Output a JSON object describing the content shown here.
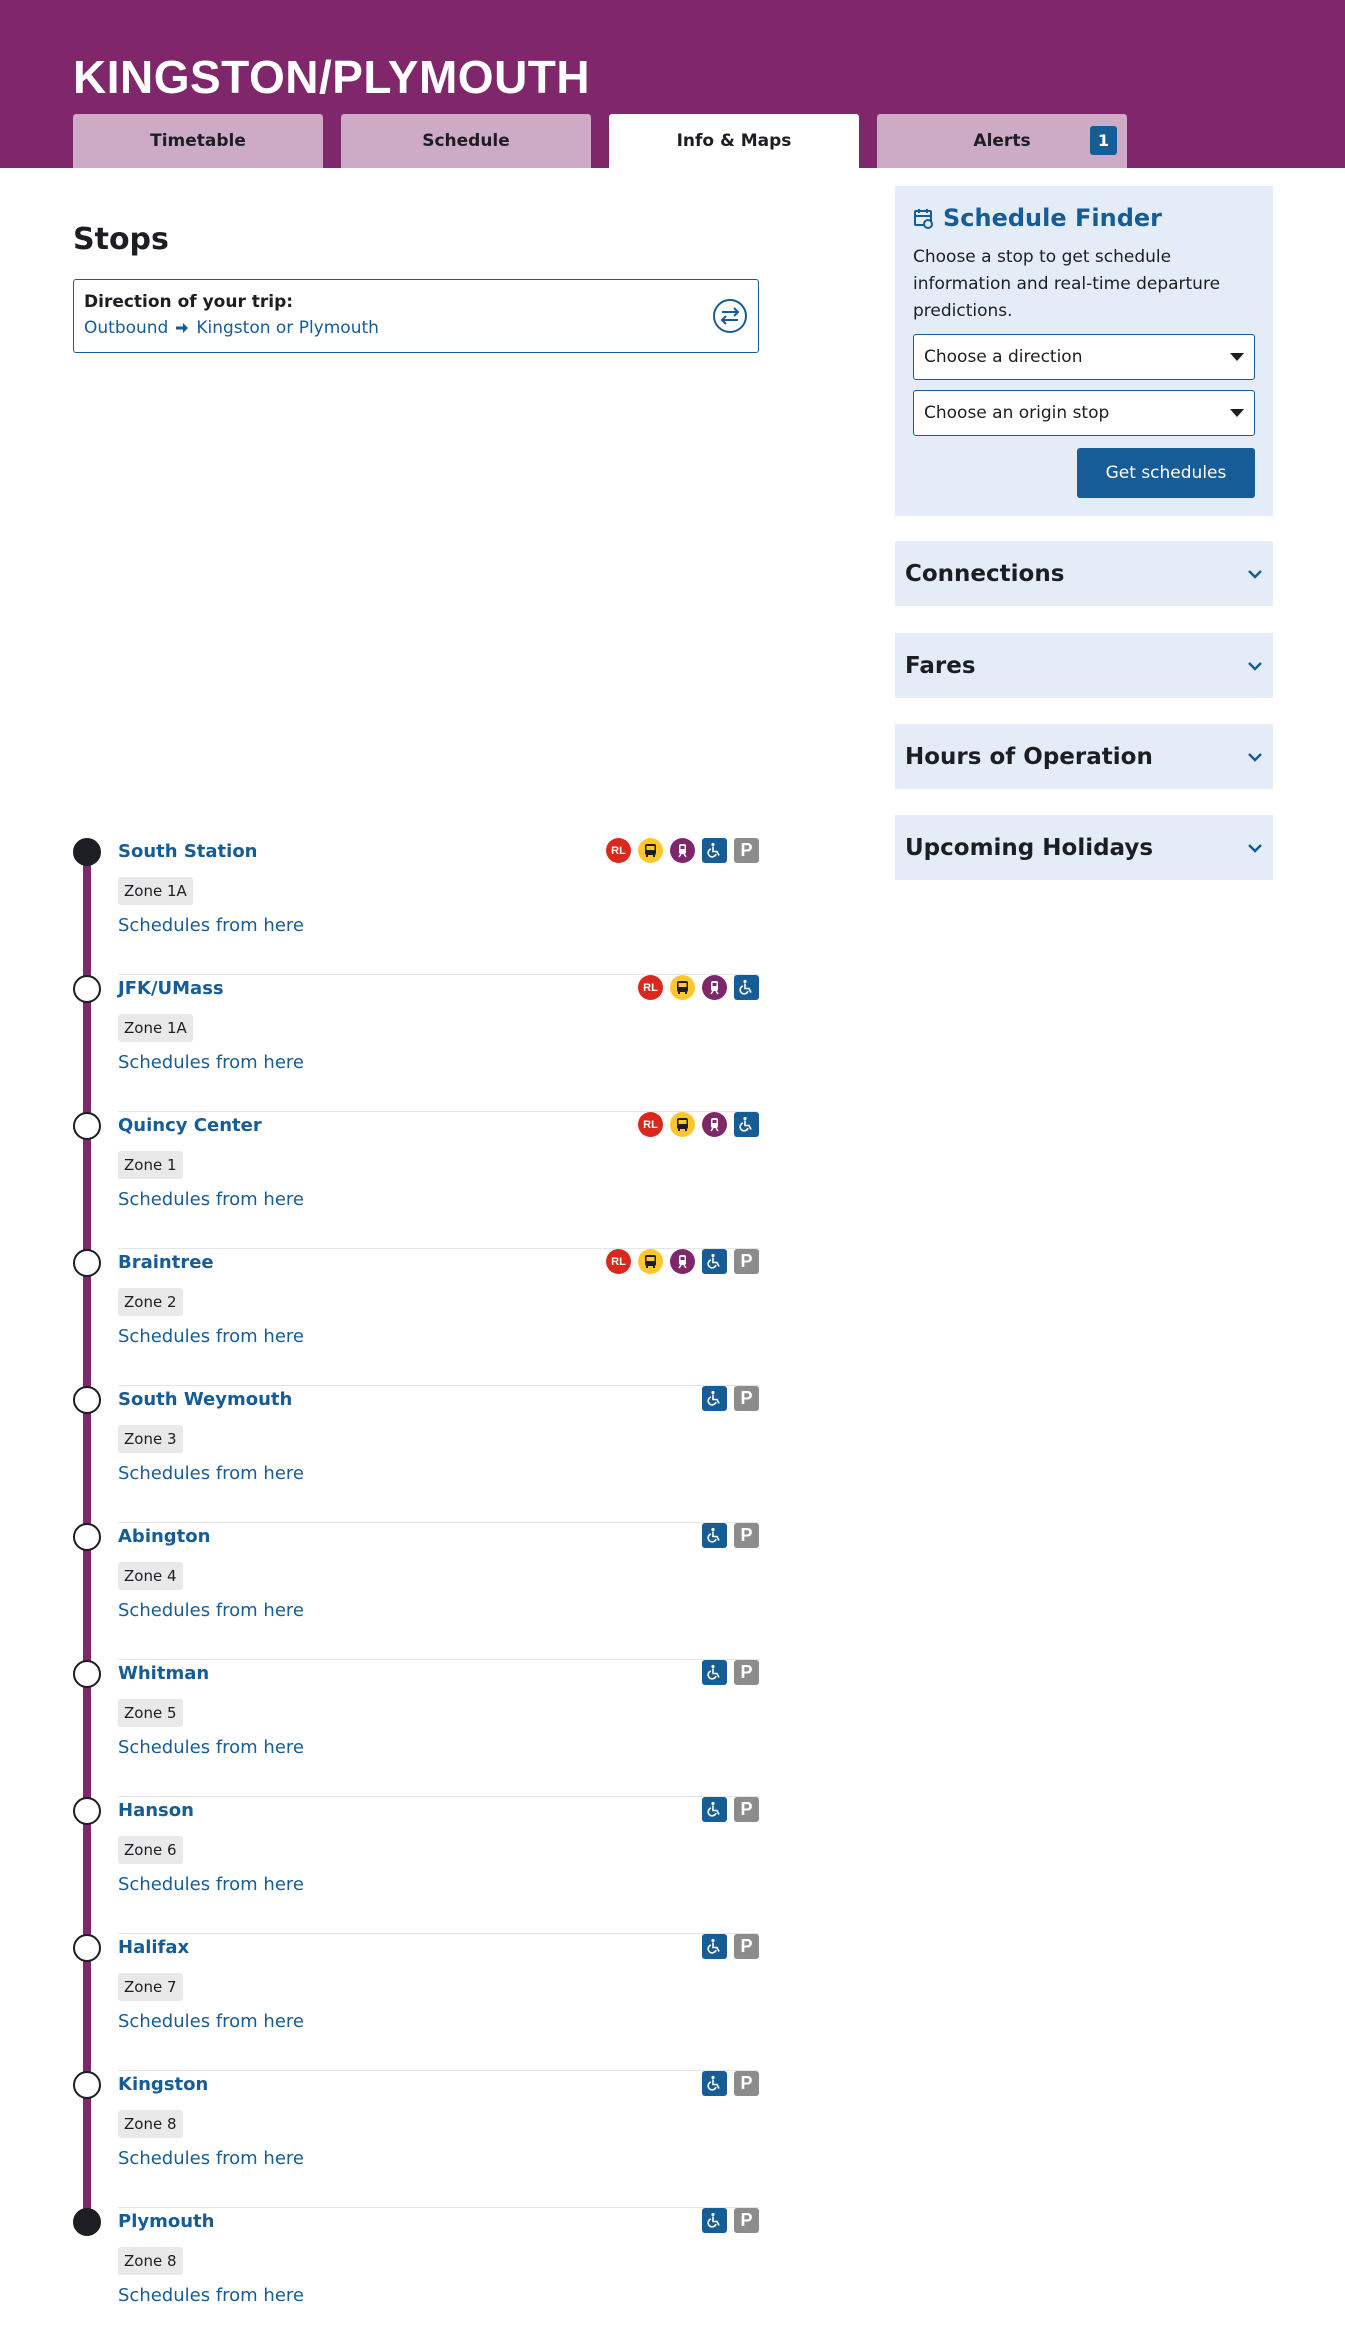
{
  "header": {
    "route_title": "KINGSTON/PLYMOUTH",
    "tabs": [
      {
        "label": "Timetable",
        "active": false
      },
      {
        "label": "Schedule",
        "active": false
      },
      {
        "label": "Info & Maps",
        "active": true
      },
      {
        "label": "Alerts",
        "active": false,
        "badge": "1"
      }
    ]
  },
  "stops_section": {
    "title": "Stops",
    "direction": {
      "label": "Direction of your trip:",
      "direction_name": "Outbound",
      "destination": "Kingston or Plymouth",
      "swap_icon": "swap-direction-icon"
    },
    "stops": [
      {
        "name": "South Station",
        "zone": "Zone 1A",
        "link": "Schedules from here",
        "terminal": true,
        "icons": [
          "rl",
          "bus",
          "cr",
          "accessible",
          "parking"
        ]
      },
      {
        "name": "JFK/UMass",
        "zone": "Zone 1A",
        "link": "Schedules from here",
        "terminal": false,
        "icons": [
          "rl",
          "bus",
          "cr",
          "accessible"
        ]
      },
      {
        "name": "Quincy Center",
        "zone": "Zone 1",
        "link": "Schedules from here",
        "terminal": false,
        "icons": [
          "rl",
          "bus",
          "cr",
          "accessible"
        ]
      },
      {
        "name": "Braintree",
        "zone": "Zone 2",
        "link": "Schedules from here",
        "terminal": false,
        "icons": [
          "rl",
          "bus",
          "cr",
          "accessible",
          "parking"
        ]
      },
      {
        "name": "South Weymouth",
        "zone": "Zone 3",
        "link": "Schedules from here",
        "terminal": false,
        "icons": [
          "accessible",
          "parking"
        ]
      },
      {
        "name": "Abington",
        "zone": "Zone 4",
        "link": "Schedules from here",
        "terminal": false,
        "icons": [
          "accessible",
          "parking"
        ]
      },
      {
        "name": "Whitman",
        "zone": "Zone 5",
        "link": "Schedules from here",
        "terminal": false,
        "icons": [
          "accessible",
          "parking"
        ]
      },
      {
        "name": "Hanson",
        "zone": "Zone 6",
        "link": "Schedules from here",
        "terminal": false,
        "icons": [
          "accessible",
          "parking"
        ]
      },
      {
        "name": "Halifax",
        "zone": "Zone 7",
        "link": "Schedules from here",
        "terminal": false,
        "icons": [
          "accessible",
          "parking"
        ]
      },
      {
        "name": "Kingston",
        "zone": "Zone 8",
        "link": "Schedules from here",
        "terminal": false,
        "icons": [
          "accessible",
          "parking"
        ]
      },
      {
        "name": "Plymouth",
        "zone": "Zone 8",
        "link": "Schedules from here",
        "terminal": true,
        "icons": [
          "accessible",
          "parking"
        ]
      }
    ]
  },
  "icon_labels": {
    "rl": "RL",
    "parking": "P"
  },
  "sidebar": {
    "schedule_finder": {
      "title": "Schedule Finder",
      "description": "Choose a stop to get schedule information and real-time departure predictions.",
      "direction_select": "Choose a direction",
      "origin_select": "Choose an origin stop",
      "button": "Get schedules"
    },
    "accordions": [
      "Connections",
      "Fares",
      "Hours of Operation",
      "Upcoming Holidays"
    ]
  },
  "colors": {
    "route": "#80276c",
    "link": "#165c96",
    "red_line": "#da291c",
    "bus": "#ffc72c",
    "panel": "#e4edf7"
  }
}
